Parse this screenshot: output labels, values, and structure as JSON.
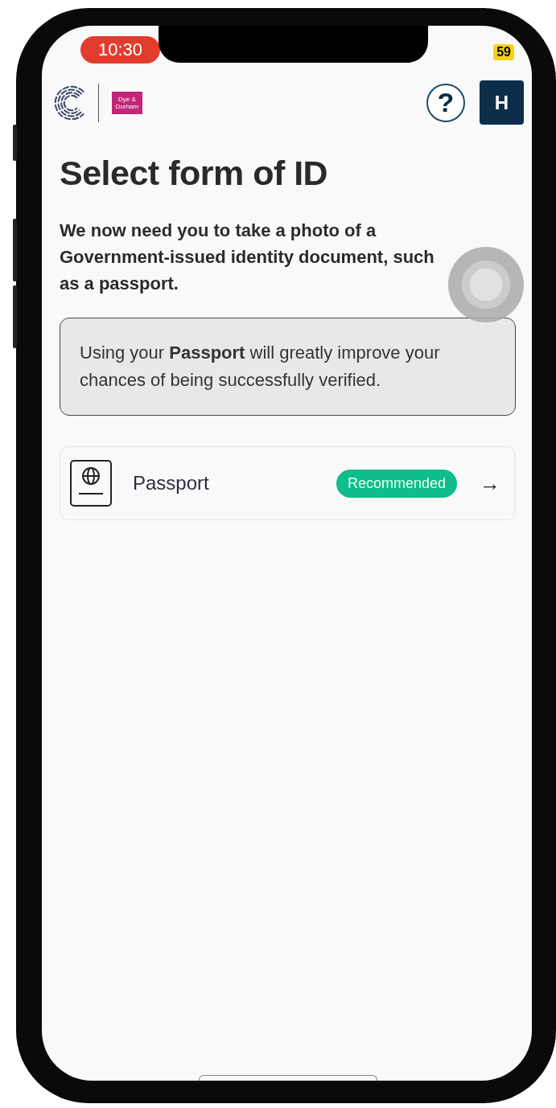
{
  "status_bar": {
    "time": "10:30",
    "battery": "59"
  },
  "header": {
    "partner_logo_text": "Dye & Durham",
    "help_label": "?",
    "avatar_initial": "H"
  },
  "title": "Select form of ID",
  "intro": "We now need you to take a photo of a Government-issued identity document, such as a passport.",
  "notice": "Using your **Passport** will greatly improve your chances of being successfully verified.",
  "options": [
    {
      "label": "Passport",
      "badge": "Recommended",
      "arrow": "→"
    }
  ]
}
